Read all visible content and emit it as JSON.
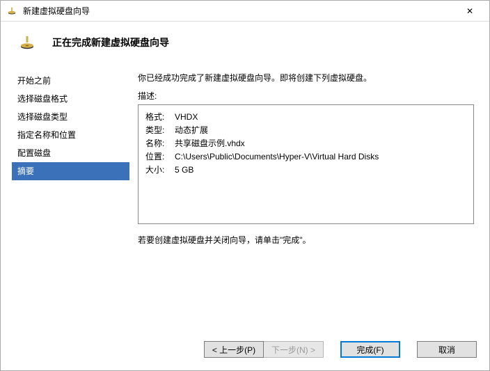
{
  "window": {
    "title": "新建虚拟硬盘向导",
    "close_glyph": "✕"
  },
  "header": {
    "title": "正在完成新建虚拟硬盘向导"
  },
  "sidebar": {
    "steps": [
      "开始之前",
      "选择磁盘格式",
      "选择磁盘类型",
      "指定名称和位置",
      "配置磁盘",
      "摘要"
    ],
    "active_index": 5
  },
  "content": {
    "intro": "你已经成功完成了新建虚拟硬盘向导。即将创建下列虚拟硬盘。",
    "desc_label": "描述:",
    "summary": {
      "format_k": "格式:",
      "format_v": "VHDX",
      "type_k": "类型:",
      "type_v": "动态扩展",
      "name_k": "名称:",
      "name_v": "共享磁盘示例.vhdx",
      "loc_k": "位置:",
      "loc_v": "C:\\Users\\Public\\Documents\\Hyper-V\\Virtual Hard Disks",
      "size_k": "大小:",
      "size_v": "5 GB"
    },
    "closing": "若要创建虚拟硬盘并关闭向导，请单击\"完成\"。"
  },
  "buttons": {
    "prev": "< 上一步(P)",
    "next": "下一步(N) >",
    "finish": "完成(F)",
    "cancel": "取消"
  }
}
